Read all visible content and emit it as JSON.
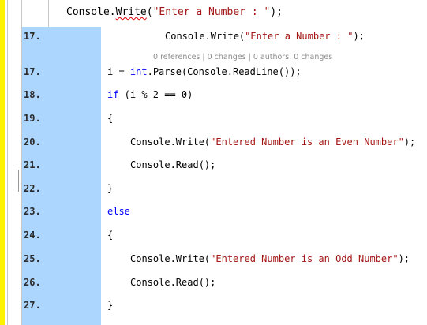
{
  "top_line": {
    "pre": "Console.",
    "method": "Write",
    "paren": "(",
    "string": "\"Enter a Number : \"",
    "post": ");"
  },
  "codelens": "0 references | 0 changes | 0 authors, 0 changes",
  "lines": [
    {
      "num": "17.",
      "c1": "Console.Write(",
      "c2": "\"Enter a Number : \"",
      "c3": ");"
    },
    {
      "num": "17.",
      "c1": "i = ",
      "c2": "int",
      "c3": ".Parse(Console.ReadLine());"
    },
    {
      "num": "18.",
      "c1": "if",
      "c2": " (i % 2 == 0)"
    },
    {
      "num": "19.",
      "c1": "{"
    },
    {
      "num": "20.",
      "c1": "Console.Write(",
      "c2": "\"Entered Number is an Even Number\"",
      "c3": ");"
    },
    {
      "num": "21.",
      "c1": "Console.Read();"
    },
    {
      "num": "22.",
      "c1": "}"
    },
    {
      "num": "23.",
      "c1": "else"
    },
    {
      "num": "24.",
      "c1": "{"
    },
    {
      "num": "25.",
      "c1": "Console.Write(",
      "c2": "\"Entered Number is an Odd Number\"",
      "c3": ");"
    },
    {
      "num": "26.",
      "c1": "Console.Read();"
    },
    {
      "num": "27.",
      "c1": "}"
    }
  ],
  "colors": {
    "selection": "#add6ff",
    "string": "#a31515",
    "keyword": "#0000ff",
    "indicator": "#fff100"
  }
}
